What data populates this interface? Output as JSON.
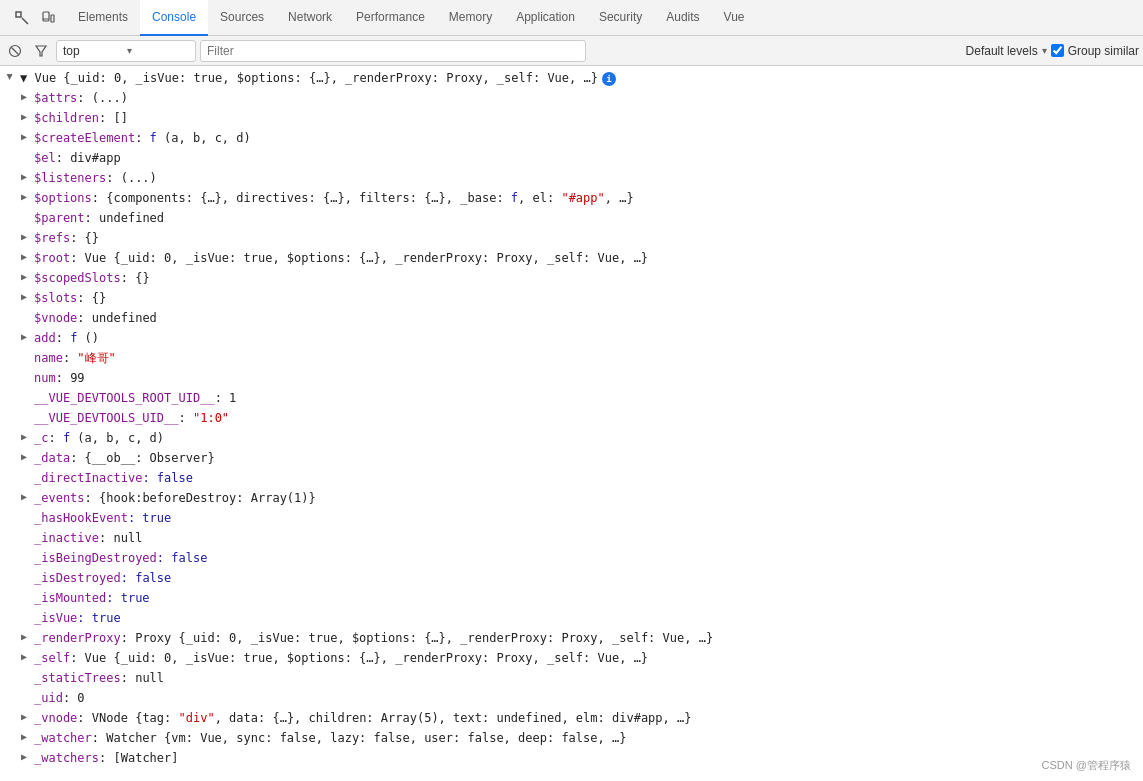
{
  "tabs": [
    {
      "id": "elements",
      "label": "Elements",
      "active": false
    },
    {
      "id": "console",
      "label": "Console",
      "active": true
    },
    {
      "id": "sources",
      "label": "Sources",
      "active": false
    },
    {
      "id": "network",
      "label": "Network",
      "active": false
    },
    {
      "id": "performance",
      "label": "Performance",
      "active": false
    },
    {
      "id": "memory",
      "label": "Memory",
      "active": false
    },
    {
      "id": "application",
      "label": "Application",
      "active": false
    },
    {
      "id": "security",
      "label": "Security",
      "active": false
    },
    {
      "id": "audits",
      "label": "Audits",
      "active": false
    },
    {
      "id": "vue",
      "label": "Vue",
      "active": false
    }
  ],
  "toolbar": {
    "context_value": "top",
    "filter_placeholder": "Filter",
    "default_levels_label": "Default levels",
    "group_similar_label": "Group similar",
    "group_similar_checked": true
  },
  "watermark": "CSDN @管程序猿",
  "console_lines": [
    {
      "id": "line-vue-root",
      "indent": 0,
      "expandable": true,
      "expanded": true,
      "arrow_dir": "expanded",
      "parts": [
        {
          "text": "▼ Vue {_uid: 0, _isVue: true, $options: {…}, _renderProxy: Proxy, _self: Vue, …}",
          "color": "c-dark"
        },
        {
          "text": " ℹ",
          "color": "info"
        }
      ]
    },
    {
      "id": "line-attrs",
      "indent": 1,
      "expandable": true,
      "expanded": false,
      "parts": [
        {
          "text": "$attrs",
          "color": "c-purple"
        },
        {
          "text": ": (...)",
          "color": "c-dark"
        }
      ]
    },
    {
      "id": "line-children",
      "indent": 1,
      "expandable": true,
      "expanded": false,
      "parts": [
        {
          "text": "$children",
          "color": "c-purple"
        },
        {
          "text": ": []",
          "color": "c-dark"
        }
      ]
    },
    {
      "id": "line-createElement",
      "indent": 1,
      "expandable": true,
      "expanded": false,
      "parts": [
        {
          "text": "$createElement",
          "color": "c-purple"
        },
        {
          "text": ": ",
          "color": "c-dark"
        },
        {
          "text": "f",
          "color": "c-blue"
        },
        {
          "text": " (a, b, c, d)",
          "color": "c-dark"
        }
      ]
    },
    {
      "id": "line-el",
      "indent": 1,
      "expandable": false,
      "parts": [
        {
          "text": "$el",
          "color": "c-purple"
        },
        {
          "text": ": div#app",
          "color": "c-dark"
        }
      ]
    },
    {
      "id": "line-listeners",
      "indent": 1,
      "expandable": true,
      "expanded": false,
      "parts": [
        {
          "text": "$listeners",
          "color": "c-purple"
        },
        {
          "text": ": (...)",
          "color": "c-dark"
        }
      ]
    },
    {
      "id": "line-options",
      "indent": 1,
      "expandable": true,
      "expanded": false,
      "parts": [
        {
          "text": "$options",
          "color": "c-purple"
        },
        {
          "text": ": {components: {…}, directives: {…}, filters: {…}, _base: ",
          "color": "c-dark"
        },
        {
          "text": "f",
          "color": "c-blue"
        },
        {
          "text": ", el: ",
          "color": "c-dark"
        },
        {
          "text": "\"#app\"",
          "color": "c-red"
        },
        {
          "text": ", …}",
          "color": "c-dark"
        }
      ]
    },
    {
      "id": "line-parent",
      "indent": 1,
      "expandable": false,
      "parts": [
        {
          "text": "$parent",
          "color": "c-purple"
        },
        {
          "text": ": undefined",
          "color": "c-dark"
        }
      ]
    },
    {
      "id": "line-refs",
      "indent": 1,
      "expandable": true,
      "expanded": false,
      "parts": [
        {
          "text": "$refs",
          "color": "c-purple"
        },
        {
          "text": ": {}",
          "color": "c-dark"
        }
      ]
    },
    {
      "id": "line-root",
      "indent": 1,
      "expandable": true,
      "expanded": false,
      "parts": [
        {
          "text": "$root",
          "color": "c-purple"
        },
        {
          "text": ": Vue {_uid: 0, _isVue: true, $options: {…}, _renderProxy: Proxy, _self: Vue, …}",
          "color": "c-dark"
        }
      ]
    },
    {
      "id": "line-scopedSlots",
      "indent": 1,
      "expandable": true,
      "expanded": false,
      "parts": [
        {
          "text": "$scopedSlots",
          "color": "c-purple"
        },
        {
          "text": ": {}",
          "color": "c-dark"
        }
      ]
    },
    {
      "id": "line-slots",
      "indent": 1,
      "expandable": true,
      "expanded": false,
      "parts": [
        {
          "text": "$slots",
          "color": "c-purple"
        },
        {
          "text": ": {}",
          "color": "c-dark"
        }
      ]
    },
    {
      "id": "line-vnode",
      "indent": 1,
      "expandable": false,
      "parts": [
        {
          "text": "$vnode",
          "color": "c-purple"
        },
        {
          "text": ": undefined",
          "color": "c-dark"
        }
      ]
    },
    {
      "id": "line-add",
      "indent": 1,
      "expandable": true,
      "expanded": false,
      "parts": [
        {
          "text": "add",
          "color": "c-purple"
        },
        {
          "text": ": ",
          "color": "c-dark"
        },
        {
          "text": "f",
          "color": "c-blue"
        },
        {
          "text": " ()",
          "color": "c-dark"
        }
      ]
    },
    {
      "id": "line-name",
      "indent": 1,
      "expandable": false,
      "parts": [
        {
          "text": "name",
          "color": "c-purple"
        },
        {
          "text": ": ",
          "color": "c-dark"
        },
        {
          "text": "\"峰哥\"",
          "color": "c-red"
        }
      ]
    },
    {
      "id": "line-num",
      "indent": 1,
      "expandable": false,
      "parts": [
        {
          "text": "num",
          "color": "c-purple"
        },
        {
          "text": ": 99",
          "color": "c-dark"
        }
      ]
    },
    {
      "id": "line-devtools-root-uid",
      "indent": 1,
      "expandable": false,
      "parts": [
        {
          "text": "__VUE_DEVTOOLS_ROOT_UID__",
          "color": "c-purple"
        },
        {
          "text": ": 1",
          "color": "c-dark"
        }
      ]
    },
    {
      "id": "line-devtools-uid",
      "indent": 1,
      "expandable": false,
      "parts": [
        {
          "text": "__VUE_DEVTOOLS_UID__",
          "color": "c-purple"
        },
        {
          "text": ": ",
          "color": "c-dark"
        },
        {
          "text": "\"1:0\"",
          "color": "c-red"
        }
      ]
    },
    {
      "id": "line-c",
      "indent": 1,
      "expandable": true,
      "expanded": false,
      "parts": [
        {
          "text": "_c",
          "color": "c-purple"
        },
        {
          "text": ": ",
          "color": "c-dark"
        },
        {
          "text": "f",
          "color": "c-blue"
        },
        {
          "text": " (a, b, c, d)",
          "color": "c-dark"
        }
      ]
    },
    {
      "id": "line-data",
      "indent": 1,
      "expandable": true,
      "expanded": false,
      "parts": [
        {
          "text": "_data",
          "color": "c-purple"
        },
        {
          "text": ": {__ob__: Observer}",
          "color": "c-dark"
        }
      ]
    },
    {
      "id": "line-directInactive",
      "indent": 1,
      "expandable": false,
      "parts": [
        {
          "text": "_directInactive",
          "color": "c-purple"
        },
        {
          "text": ": false",
          "color": "c-blue"
        }
      ]
    },
    {
      "id": "line-events",
      "indent": 1,
      "expandable": true,
      "expanded": false,
      "parts": [
        {
          "text": "_events",
          "color": "c-purple"
        },
        {
          "text": ": {hook:beforeDestroy: Array(1)}",
          "color": "c-dark"
        }
      ]
    },
    {
      "id": "line-hasHookEvent",
      "indent": 1,
      "expandable": false,
      "parts": [
        {
          "text": "_hasHookEvent",
          "color": "c-purple"
        },
        {
          "text": ": true",
          "color": "c-blue"
        }
      ]
    },
    {
      "id": "line-inactive",
      "indent": 1,
      "expandable": false,
      "parts": [
        {
          "text": "_inactive",
          "color": "c-purple"
        },
        {
          "text": ": null",
          "color": "c-dark"
        }
      ]
    },
    {
      "id": "line-isBeingDestroyed",
      "indent": 1,
      "expandable": false,
      "parts": [
        {
          "text": "_isBeingDestroyed",
          "color": "c-purple"
        },
        {
          "text": ": false",
          "color": "c-blue"
        }
      ]
    },
    {
      "id": "line-isDestroyed",
      "indent": 1,
      "expandable": false,
      "parts": [
        {
          "text": "_isDestroyed",
          "color": "c-purple"
        },
        {
          "text": ": false",
          "color": "c-blue"
        }
      ]
    },
    {
      "id": "line-isMounted",
      "indent": 1,
      "expandable": false,
      "parts": [
        {
          "text": "_isMounted",
          "color": "c-purple"
        },
        {
          "text": ": true",
          "color": "c-blue"
        }
      ]
    },
    {
      "id": "line-isVue",
      "indent": 1,
      "expandable": false,
      "parts": [
        {
          "text": "_isVue",
          "color": "c-purple"
        },
        {
          "text": ": true",
          "color": "c-blue"
        }
      ]
    },
    {
      "id": "line-renderProxy",
      "indent": 1,
      "expandable": true,
      "expanded": false,
      "parts": [
        {
          "text": "_renderProxy",
          "color": "c-purple"
        },
        {
          "text": ": Proxy {_uid: 0, _isVue: true, $options: {…}, _renderProxy: Proxy, _self: Vue, …}",
          "color": "c-dark"
        }
      ]
    },
    {
      "id": "line-self",
      "indent": 1,
      "expandable": true,
      "expanded": false,
      "parts": [
        {
          "text": "_self",
          "color": "c-purple"
        },
        {
          "text": ": Vue {_uid: 0, _isVue: true, $options: {…}, _renderProxy: Proxy, _self: Vue, …}",
          "color": "c-dark"
        }
      ]
    },
    {
      "id": "line-staticTrees",
      "indent": 1,
      "expandable": false,
      "parts": [
        {
          "text": "_staticTrees",
          "color": "c-purple"
        },
        {
          "text": ": null",
          "color": "c-dark"
        }
      ]
    },
    {
      "id": "line-uid",
      "indent": 1,
      "expandable": false,
      "parts": [
        {
          "text": "_uid",
          "color": "c-purple"
        },
        {
          "text": ": 0",
          "color": "c-dark"
        }
      ]
    },
    {
      "id": "line-vnode2",
      "indent": 1,
      "expandable": true,
      "expanded": false,
      "parts": [
        {
          "text": "_vnode",
          "color": "c-purple"
        },
        {
          "text": ": VNode {tag: ",
          "color": "c-dark"
        },
        {
          "text": "\"div\"",
          "color": "c-red"
        },
        {
          "text": ", data: {…}, children: Array(5), text: undefined, elm: div#app, …}",
          "color": "c-dark"
        }
      ]
    },
    {
      "id": "line-watcher",
      "indent": 1,
      "expandable": true,
      "expanded": false,
      "parts": [
        {
          "text": "_watcher",
          "color": "c-purple"
        },
        {
          "text": ": Watcher {vm: Vue, sync: false, lazy: false, user: false, deep: false, …}",
          "color": "c-dark"
        }
      ]
    },
    {
      "id": "line-watchers",
      "indent": 1,
      "expandable": true,
      "expanded": false,
      "parts": [
        {
          "text": "_watchers",
          "color": "c-purple"
        },
        {
          "text": ": [Watcher]",
          "color": "c-dark"
        }
      ]
    }
  ]
}
